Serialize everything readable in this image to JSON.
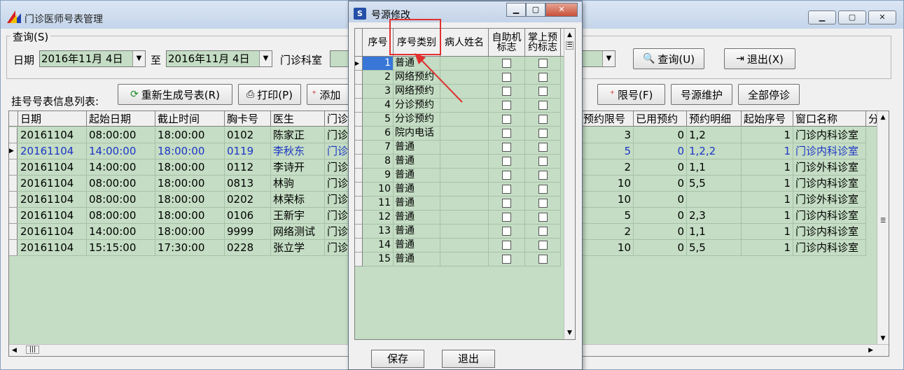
{
  "main": {
    "title": "门诊医师号表管理",
    "window_buttons": [
      "▁",
      "▢",
      "✕"
    ],
    "query": {
      "legend": "查询(S)",
      "date_label": "日期",
      "date_from": "2016年11月 4日",
      "to_label": "至",
      "date_to": "2016年11月 4日",
      "dept_label": "门诊科室",
      "dept_value": "",
      "query_button": "查询(U)",
      "exit_button": "退出(X)"
    },
    "list_label": "挂号号表信息列表:",
    "toolbar": {
      "regen": "重新生成号表(R)",
      "print": "打印(P)",
      "add": "添加",
      "limit": "限号(F)",
      "maintain": "号源维护",
      "stop_all": "全部停诊"
    },
    "grid": {
      "left_headers": [
        "日期",
        "起始日期",
        "截止时间",
        "胸卡号",
        "医生",
        "门诊"
      ],
      "right_headers": [
        "预约限号",
        "已用预约",
        "预约明细",
        "起始序号",
        "窗口名称",
        "分"
      ],
      "rows": [
        {
          "date": "20161104",
          "start": "08:00:00",
          "end": "18:00:00",
          "card": "0102",
          "doctor": "陈家正",
          "dept": "门诊",
          "limit": "3",
          "used": "0",
          "detail": "1,2",
          "seq": "1",
          "window": "门诊内科诊室"
        },
        {
          "date": "20161104",
          "start": "14:00:00",
          "end": "18:00:00",
          "card": "0119",
          "doctor": "李秋东",
          "dept": "门诊",
          "limit": "5",
          "used": "0",
          "detail": "1,2,2",
          "seq": "1",
          "window": "门诊内科诊室"
        },
        {
          "date": "20161104",
          "start": "14:00:00",
          "end": "18:00:00",
          "card": "0112",
          "doctor": "李诗开",
          "dept": "门诊",
          "limit": "2",
          "used": "0",
          "detail": "1,1",
          "seq": "1",
          "window": "门诊外科诊室"
        },
        {
          "date": "20161104",
          "start": "08:00:00",
          "end": "18:00:00",
          "card": "0813",
          "doctor": "林驹",
          "dept": "门诊",
          "limit": "10",
          "used": "0",
          "detail": "5,5",
          "seq": "1",
          "window": "门诊内科诊室"
        },
        {
          "date": "20161104",
          "start": "08:00:00",
          "end": "18:00:00",
          "card": "0202",
          "doctor": "林荣标",
          "dept": "门诊",
          "limit": "10",
          "used": "0",
          "detail": "",
          "seq": "1",
          "window": "门诊外科诊室"
        },
        {
          "date": "20161104",
          "start": "08:00:00",
          "end": "18:00:00",
          "card": "0106",
          "doctor": "王新宇",
          "dept": "门诊",
          "limit": "5",
          "used": "0",
          "detail": "2,3",
          "seq": "1",
          "window": "门诊内科诊室"
        },
        {
          "date": "20161104",
          "start": "14:00:00",
          "end": "18:00:00",
          "card": "9999",
          "doctor": "网络测试",
          "dept": "门诊",
          "limit": "2",
          "used": "0",
          "detail": "1,1",
          "seq": "1",
          "window": "门诊内科诊室"
        },
        {
          "date": "20161104",
          "start": "15:15:00",
          "end": "17:30:00",
          "card": "0228",
          "doctor": "张立学",
          "dept": "门诊",
          "limit": "10",
          "used": "0",
          "detail": "5,5",
          "seq": "1",
          "window": "门诊内科诊室"
        }
      ]
    }
  },
  "dialog": {
    "title": "号源修改",
    "headers": [
      "序号",
      "序号类别",
      "病人姓名",
      "自助机标志",
      "掌上预约标志"
    ],
    "rows": [
      {
        "no": "1",
        "type": "普通"
      },
      {
        "no": "2",
        "type": "网络预约"
      },
      {
        "no": "3",
        "type": "网络预约"
      },
      {
        "no": "4",
        "type": "分诊预约"
      },
      {
        "no": "5",
        "type": "分诊预约"
      },
      {
        "no": "6",
        "type": "院内电话"
      },
      {
        "no": "7",
        "type": "普通"
      },
      {
        "no": "8",
        "type": "普通"
      },
      {
        "no": "9",
        "type": "普通"
      },
      {
        "no": "10",
        "type": "普通"
      },
      {
        "no": "11",
        "type": "普通"
      },
      {
        "no": "12",
        "type": "普通"
      },
      {
        "no": "13",
        "type": "普通"
      },
      {
        "no": "14",
        "type": "普通"
      },
      {
        "no": "15",
        "type": "普通"
      }
    ],
    "save_button": "保存",
    "exit_button": "退出"
  },
  "colors": {
    "grid_bg": "#c4ddc4",
    "selected_text": "#1d35c5",
    "annotation": "#e03030"
  }
}
